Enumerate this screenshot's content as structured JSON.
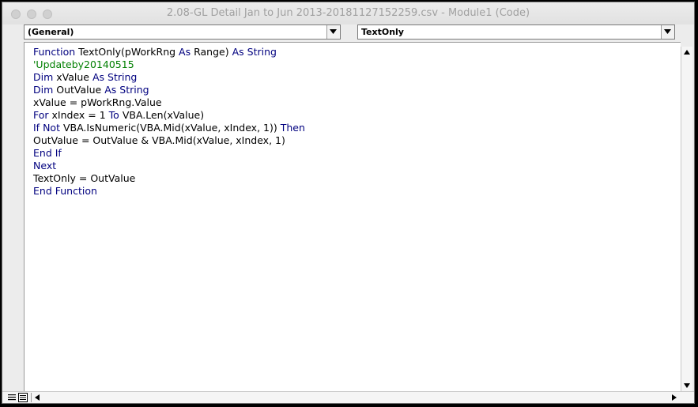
{
  "window": {
    "title": "2.08-GL Detail Jan to Jun 2013-20181127152259.csv - Module1 (Code)"
  },
  "toolbar": {
    "object_combo": "(General)",
    "procedure_combo": "TextOnly"
  },
  "code_lines": [
    [
      {
        "t": "Function",
        "c": "kw"
      },
      {
        "t": " TextOnly(pWorkRng ",
        "c": "tx"
      },
      {
        "t": "As",
        "c": "kw"
      },
      {
        "t": " Range) ",
        "c": "tx"
      },
      {
        "t": "As",
        "c": "kw"
      },
      {
        "t": " ",
        "c": "tx"
      },
      {
        "t": "String",
        "c": "kw"
      }
    ],
    [
      {
        "t": "'Updateby20140515",
        "c": "cm"
      }
    ],
    [
      {
        "t": "Dim",
        "c": "kw"
      },
      {
        "t": " xValue ",
        "c": "tx"
      },
      {
        "t": "As",
        "c": "kw"
      },
      {
        "t": " ",
        "c": "tx"
      },
      {
        "t": "String",
        "c": "kw"
      }
    ],
    [
      {
        "t": "Dim",
        "c": "kw"
      },
      {
        "t": " OutValue ",
        "c": "tx"
      },
      {
        "t": "As",
        "c": "kw"
      },
      {
        "t": " ",
        "c": "tx"
      },
      {
        "t": "String",
        "c": "kw"
      }
    ],
    [
      {
        "t": "xValue = pWorkRng.Value",
        "c": "tx"
      }
    ],
    [
      {
        "t": "For",
        "c": "kw"
      },
      {
        "t": " xIndex = 1 ",
        "c": "tx"
      },
      {
        "t": "To",
        "c": "kw"
      },
      {
        "t": " VBA.Len(xValue)",
        "c": "tx"
      }
    ],
    [
      {
        "t": "If",
        "c": "kw"
      },
      {
        "t": " ",
        "c": "tx"
      },
      {
        "t": "Not",
        "c": "kw"
      },
      {
        "t": " VBA.IsNumeric(VBA.Mid(xValue, xIndex, 1)) ",
        "c": "tx"
      },
      {
        "t": "Then",
        "c": "kw"
      }
    ],
    [
      {
        "t": "OutValue = OutValue & VBA.Mid(xValue, xIndex, 1)",
        "c": "tx"
      }
    ],
    [
      {
        "t": "End If",
        "c": "kw"
      }
    ],
    [
      {
        "t": "Next",
        "c": "kw"
      }
    ],
    [
      {
        "t": "TextOnly = OutValue",
        "c": "tx"
      }
    ],
    [
      {
        "t": "End Function",
        "c": "kw"
      }
    ]
  ],
  "colors": {
    "keyword": "#00007f",
    "comment": "#007f00",
    "text": "#000000"
  },
  "icons": {
    "traffic_lights": [
      "close-icon",
      "minimize-icon",
      "zoom-icon"
    ],
    "scroll": [
      "arrow-up-icon",
      "arrow-down-icon",
      "arrow-left-icon",
      "arrow-right-icon"
    ],
    "views": [
      "procedure-view-icon",
      "full-module-view-icon"
    ]
  }
}
